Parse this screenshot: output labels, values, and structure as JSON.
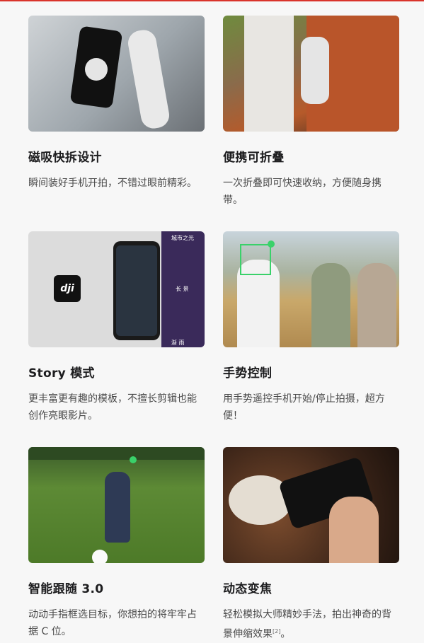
{
  "features": [
    {
      "title": "磁吸快拆设计",
      "desc": "瞬间装好手机开拍，不错过眼前精彩。",
      "image_alt": "magnetic-quick-release-photo"
    },
    {
      "title": "便携可折叠",
      "desc": "一次折叠即可快速收纳，方便随身携带。",
      "image_alt": "portable-foldable-photo"
    },
    {
      "title": "Story 模式",
      "desc": "更丰富更有趣的模板，不擅长剪辑也能创作亮眼影片。",
      "image_alt": "story-mode-app-photo",
      "image_text": {
        "logo": "dji",
        "tile_top": "城市之光",
        "tile_mid": "长 景",
        "tile_bottom": "渐 雨"
      }
    },
    {
      "title": "手势控制",
      "desc": "用手势遥控手机开始/停止拍摄，超方便！",
      "image_alt": "gesture-control-photo"
    },
    {
      "title": "智能跟随 3.0",
      "desc": "动动手指框选目标，你想拍的将牢牢占据 C 位。",
      "image_alt": "active-track-photo"
    },
    {
      "title": "动态变焦",
      "desc": "轻松模拟大师精妙手法，拍出神奇的背景伸缩效果",
      "desc_sup": "[2]",
      "desc_end": "。",
      "image_alt": "dynamic-zoom-photo"
    }
  ],
  "colors": {
    "accent": "#d9342b",
    "focus_green": "#3ad16a"
  }
}
